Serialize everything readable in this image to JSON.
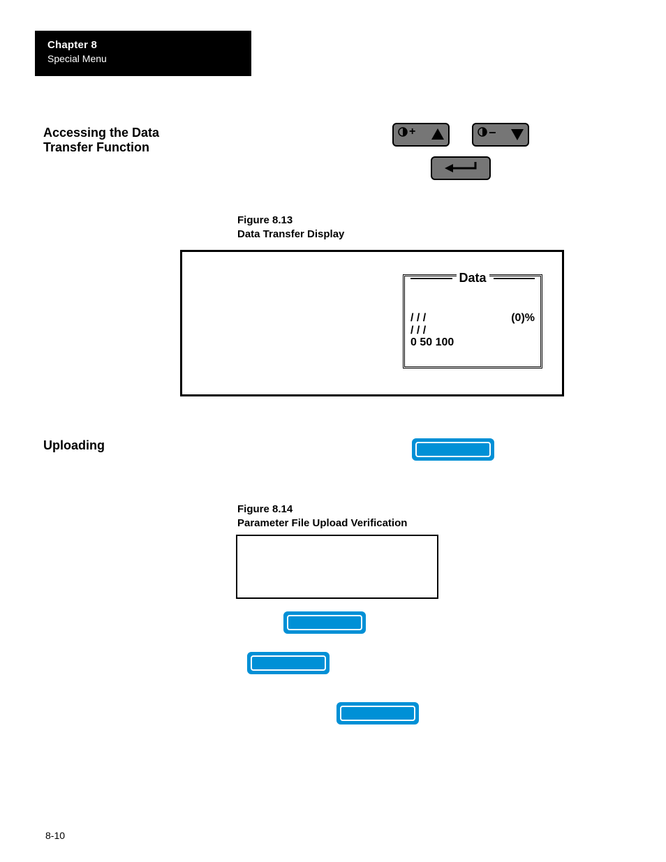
{
  "chapter": {
    "line1": "Chapter  8",
    "line2": "Special Menu"
  },
  "headings": {
    "access": "Accessing the Data Transfer Function",
    "uploading": "Uploading"
  },
  "figures": {
    "f813_num": "Figure 8.13",
    "f813_title": "Data Transfer Display",
    "f814_num": "Figure 8.14",
    "f814_title": "Parameter File Upload Verification"
  },
  "lcd": {
    "title": "Data",
    "row1_left": "/     /     /",
    "row1_right": "(0)%",
    "row2": "/     /     /",
    "row3": "0     50   100"
  },
  "page_number": "8-10",
  "icons": {
    "up": "▲",
    "down": "▼",
    "plus": "+",
    "minus": "−"
  }
}
